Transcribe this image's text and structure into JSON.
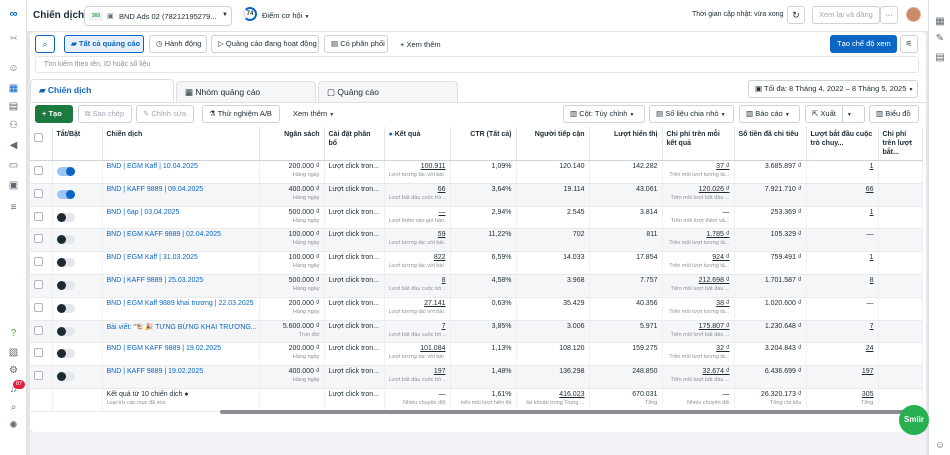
{
  "topbar": {
    "title": "Chiến dịch",
    "account_name": "BND Ads 02 (78212195279...",
    "score_value": "74",
    "score_label": "Điểm cơ hội",
    "update_status": "Thời gian cập nhật: vừa xong",
    "review_publish": "Xem lại và đăng",
    "more": "···"
  },
  "filterbar": {
    "all_ads": "Tất cả quảng cáo",
    "actions": "Hành động",
    "active_ads": "Quảng cáo đang hoạt động",
    "has_delivery": "Có phân phối",
    "view_more": "Xem thêm",
    "create_view": "Tạo chế độ xem",
    "search_placeholder": "Tìm kiếm theo tên, ID hoặc số liệu"
  },
  "tabs": {
    "campaigns": "Chiến dịch",
    "adsets": "Nhóm quảng cáo",
    "ads": "Quảng cáo",
    "date_range": "Tối đa: 8 Tháng 4, 2022 – 8 Tháng 5, 2025"
  },
  "toolbar": {
    "create": "Tạo",
    "duplicate": "Sao chép",
    "edit": "Chỉnh sửa",
    "ab_test": "Thử nghiệm A/B",
    "more": "Xem thêm",
    "columns": "Cột: Tùy chỉnh",
    "breakdown": "Số liệu chia nhỏ",
    "reports": "Báo cáo",
    "export": "Xuất",
    "charts": "Biểu đồ"
  },
  "table": {
    "headers": {
      "onoff": "Tắt/Bật",
      "campaign": "Chiến dịch",
      "budget": "Ngân sách",
      "attribution": "Cài đặt phân bổ",
      "results": "Kết quả",
      "ctr": "CTR (Tất cả)",
      "reach": "Người tiếp cận",
      "impressions": "Lượt hiển thị",
      "cost_per_result": "Chi phí trên mỗi kết quả",
      "amount_spent": "Số tiền đã chi tiêu",
      "convos": "Lượt bắt đầu cuộc trò chuy...",
      "cost_convo": "Chi phí trên lượt bắt..."
    },
    "rows": [
      {
        "name": "BND | EGM Kaff | 10.04.2025",
        "budget": "200.000 ₫",
        "attr": "Lượt click tron...",
        "result": "100.911",
        "result_sub": "Lượt tương tác với bài ...",
        "ctr": "1,09%",
        "reach": "120.140",
        "impr": "142.282",
        "cpr": "37 ₫",
        "cpr_sub": "Trên mỗi lượt tương tá...",
        "spent": "3.685.897 ₫",
        "convos": "1",
        "on": true
      },
      {
        "name": "BND | KAFF 9889 | 09.04.2025",
        "budget": "400.000 ₫",
        "attr": "Lượt click tron...",
        "result": "66",
        "result_sub": "Lượt bắt đầu cuộc trò ...",
        "ctr": "3,64%",
        "reach": "19.114",
        "impr": "43.061",
        "cpr": "120.026 ₫",
        "cpr_sub": "Trên mỗi lượt bắt đầu ...",
        "spent": "7.921.710 ₫",
        "convos": "66",
        "on": true
      },
      {
        "name": "BND | 6ap | 03.04.2025",
        "budget": "500.000 ₫",
        "attr": "Lượt click tron...",
        "result": "—",
        "result_sub": "Lượt thêm vào giỏ hàn...",
        "ctr": "2,94%",
        "reach": "2.545",
        "impr": "3.814",
        "cpr": "—",
        "cpr_sub": "Trên mỗi lượt thêm và...",
        "spent": "253.369 ₫",
        "convos": "1",
        "on": false
      },
      {
        "name": "BND | EGM KAFF 9889 | 02.04.2025",
        "budget": "100.000 ₫",
        "attr": "Lượt click tron...",
        "result": "59",
        "result_sub": "Lượt tương tác với bài ...",
        "ctr": "11,22%",
        "reach": "702",
        "impr": "811",
        "cpr": "1.785 ₫",
        "cpr_sub": "Trên mỗi lượt tương tá...",
        "spent": "105.329 ₫",
        "convos": "—",
        "on": false
      },
      {
        "name": "BND | EGM Kaff | 31.03.2025",
        "budget": "100.000 ₫",
        "attr": "Lượt click tron...",
        "result": "822",
        "result_sub": "Lượt tương tác với bài ...",
        "ctr": "6,59%",
        "reach": "14.033",
        "impr": "17.854",
        "cpr": "924 ₫",
        "cpr_sub": "Trên mỗi lượt tương tá...",
        "spent": "759.491 ₫",
        "convos": "1",
        "on": false
      },
      {
        "name": "BND | KAFF 9889 | 25.03.2025",
        "budget": "500.000 ₫",
        "attr": "Lượt click tron...",
        "result": "8",
        "result_sub": "Lượt bắt đầu cuộc trò ...",
        "ctr": "4,58%",
        "reach": "3.968",
        "impr": "7.757",
        "cpr": "212.698 ₫",
        "cpr_sub": "Trên mỗi lượt bắt đầu ...",
        "spent": "1.701.587 ₫",
        "convos": "8",
        "on": false
      },
      {
        "name": "BND | EGM Kaff 9889 khai trương | 22.03.2025",
        "budget": "200.000 ₫",
        "attr": "Lượt click tron...",
        "result": "27.141",
        "result_sub": "Lượt tương tác với bài ...",
        "ctr": "0,63%",
        "reach": "35.429",
        "impr": "40.356",
        "cpr": "38 ₫",
        "cpr_sub": "Trên mỗi lượt tương tá...",
        "spent": "1.020.600 ₫",
        "convos": "—",
        "on": false
      },
      {
        "name": "Bài viết: \"🐮🎉 TƯNG BỪNG KHAI TRƯƠNG...",
        "budget": "5.600.000 ₫",
        "budget_sub": "Trọn đời",
        "attr": "Lượt click tron...",
        "result": "7",
        "result_sub": "Lượt bắt đầu cuộc trò ...",
        "ctr": "3,85%",
        "reach": "3.006",
        "impr": "5.971",
        "cpr": "175.807 ₫",
        "cpr_sub": "Trên mỗi lượt bắt đầu ...",
        "spent": "1.230.648 ₫",
        "convos": "7",
        "on": false
      },
      {
        "name": "BND | EGM KAFF 9889 | 19.02.2025",
        "budget": "200.000 ₫",
        "attr": "Lượt click tron...",
        "result": "101.084",
        "result_sub": "Lượt tương tác với bài ...",
        "ctr": "1,13%",
        "reach": "108.120",
        "impr": "159.275",
        "cpr": "32 ₫",
        "cpr_sub": "Trên mỗi lượt tương tá...",
        "spent": "3.204.843 ₫",
        "convos": "24",
        "on": false
      },
      {
        "name": "BND | KAFF 9889 | 19.02.2025",
        "budget": "400.000 ₫",
        "attr": "Lượt click tron...",
        "result": "197",
        "result_sub": "Lượt bắt đầu cuộc trò ...",
        "ctr": "1,48%",
        "reach": "136.298",
        "impr": "248.850",
        "cpr": "32.674 ₫",
        "cpr_sub": "Trên mỗi lượt bắt đầu ...",
        "spent": "6.436.699 ₫",
        "convos": "197",
        "on": false
      }
    ],
    "daily": "Hàng ngày",
    "summary": {
      "label": "Kết quả từ 10 chiến dịch",
      "sub": "Loại trừ các mục đã xóa",
      "attr": "Lượt click tron...",
      "result": "—",
      "result_sub": "Nhiều chuyển đổi",
      "ctr": "1,61%",
      "ctr_sub": "trên mỗi lượt hiển thị",
      "reach": "416.023",
      "reach_sub": "tài khoản trong Trung ...",
      "impr": "670.031",
      "impr_sub": "Tổng",
      "cpr": "—",
      "cpr_sub": "Nhiều chuyển đổi",
      "spent": "26.320.173 ₫",
      "spent_sub": "Tổng chi tiêu",
      "convos": "305",
      "convos_sub": "Tổng"
    }
  },
  "fab_label": "Smiir",
  "notification_count": "87",
  "colors": {
    "accent": "#0a66c2",
    "create_green": "#1d7a3f",
    "fab_green": "#27b04f"
  }
}
